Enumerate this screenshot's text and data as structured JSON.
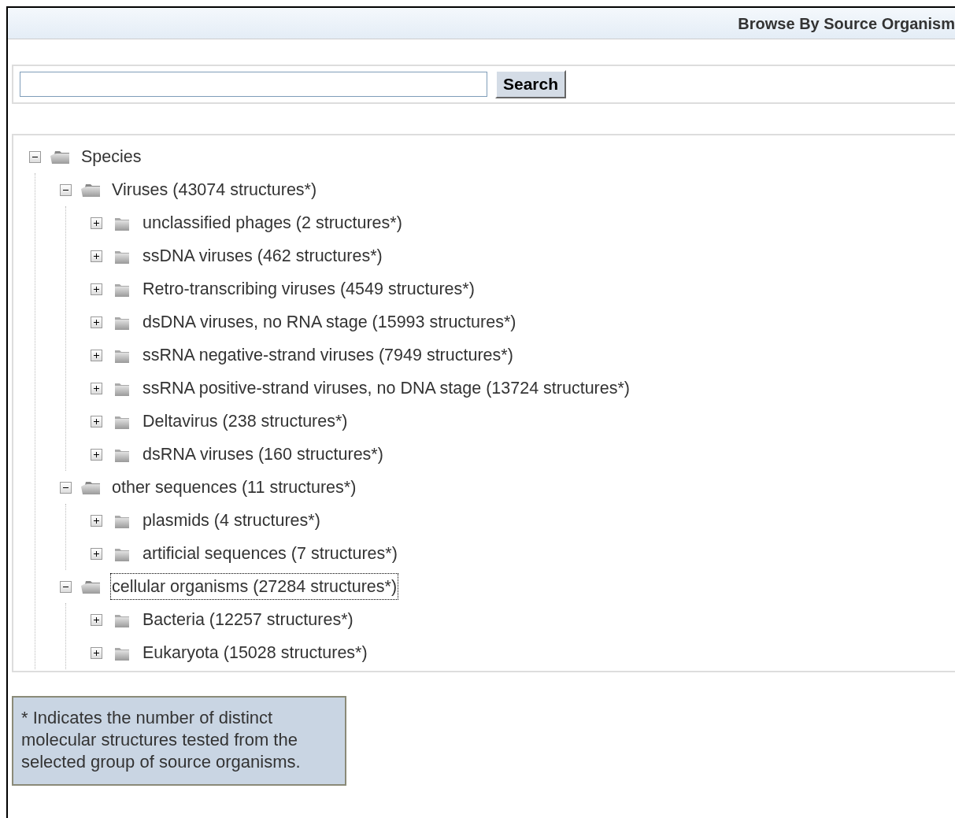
{
  "header": {
    "title": "Browse By Source Organism"
  },
  "search": {
    "button": "Search"
  },
  "tree": [
    {
      "label": "Species",
      "expanded": true,
      "selected": false,
      "children": [
        {
          "label": "Viruses (43074 structures*)",
          "expanded": true,
          "selected": false,
          "children": [
            {
              "label": "unclassified phages (2 structures*)",
              "expanded": false,
              "selected": false
            },
            {
              "label": "ssDNA viruses (462 structures*)",
              "expanded": false,
              "selected": false
            },
            {
              "label": "Retro-transcribing viruses (4549 structures*)",
              "expanded": false,
              "selected": false
            },
            {
              "label": "dsDNA viruses, no RNA stage (15993 structures*)",
              "expanded": false,
              "selected": false
            },
            {
              "label": "ssRNA negative-strand viruses (7949 structures*)",
              "expanded": false,
              "selected": false
            },
            {
              "label": "ssRNA positive-strand viruses, no DNA stage (13724 structures*)",
              "expanded": false,
              "selected": false
            },
            {
              "label": "Deltavirus (238 structures*)",
              "expanded": false,
              "selected": false
            },
            {
              "label": "dsRNA viruses (160 structures*)",
              "expanded": false,
              "selected": false
            }
          ]
        },
        {
          "label": "other sequences (11 structures*)",
          "expanded": true,
          "selected": false,
          "children": [
            {
              "label": "plasmids (4 structures*)",
              "expanded": false,
              "selected": false
            },
            {
              "label": "artificial sequences (7 structures*)",
              "expanded": false,
              "selected": false
            }
          ]
        },
        {
          "label": "cellular organisms (27284 structures*)",
          "expanded": true,
          "selected": true,
          "children": [
            {
              "label": "Bacteria (12257 structures*)",
              "expanded": false,
              "selected": false
            },
            {
              "label": "Eukaryota (15028 structures*)",
              "expanded": false,
              "selected": false
            }
          ]
        }
      ]
    }
  ],
  "footnote": "* Indicates the number of distinct molecular structures tested from the selected group of source organisms."
}
